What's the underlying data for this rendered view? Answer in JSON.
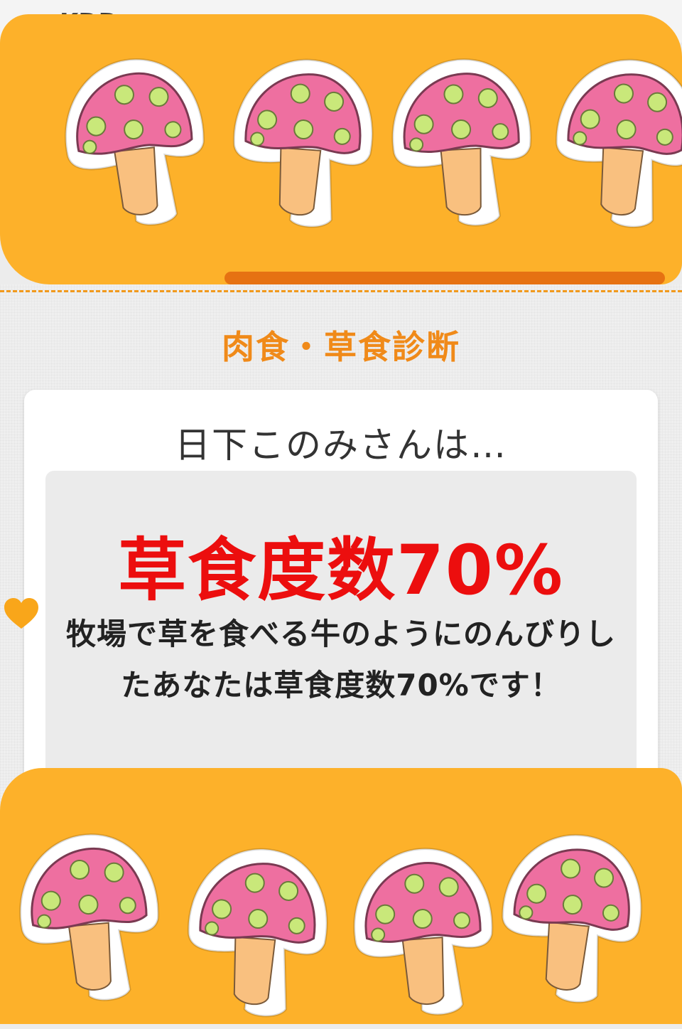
{
  "status_bar": {
    "carrier": "KDD"
  },
  "page": {
    "title": "肉食・草食診断"
  },
  "result": {
    "subject": "日下このみさんは…",
    "headline": "草食度数70%",
    "description": "牧場で草を食べる牛のようにのんびりしたあなたは草食度数70%です！",
    "herbivore_percent": 70
  },
  "decorations": {
    "sticker_icon": "mushroom-icon",
    "heart_icon": "heart-icon",
    "colors": {
      "accent_orange": "#f08a19",
      "scribble_orange": "#fdb12a",
      "headline_red": "#ec0e0e",
      "mushroom_cap": "#ee6fa0",
      "mushroom_spot": "#c9e87a",
      "mushroom_stem": "#f9c07f"
    }
  }
}
